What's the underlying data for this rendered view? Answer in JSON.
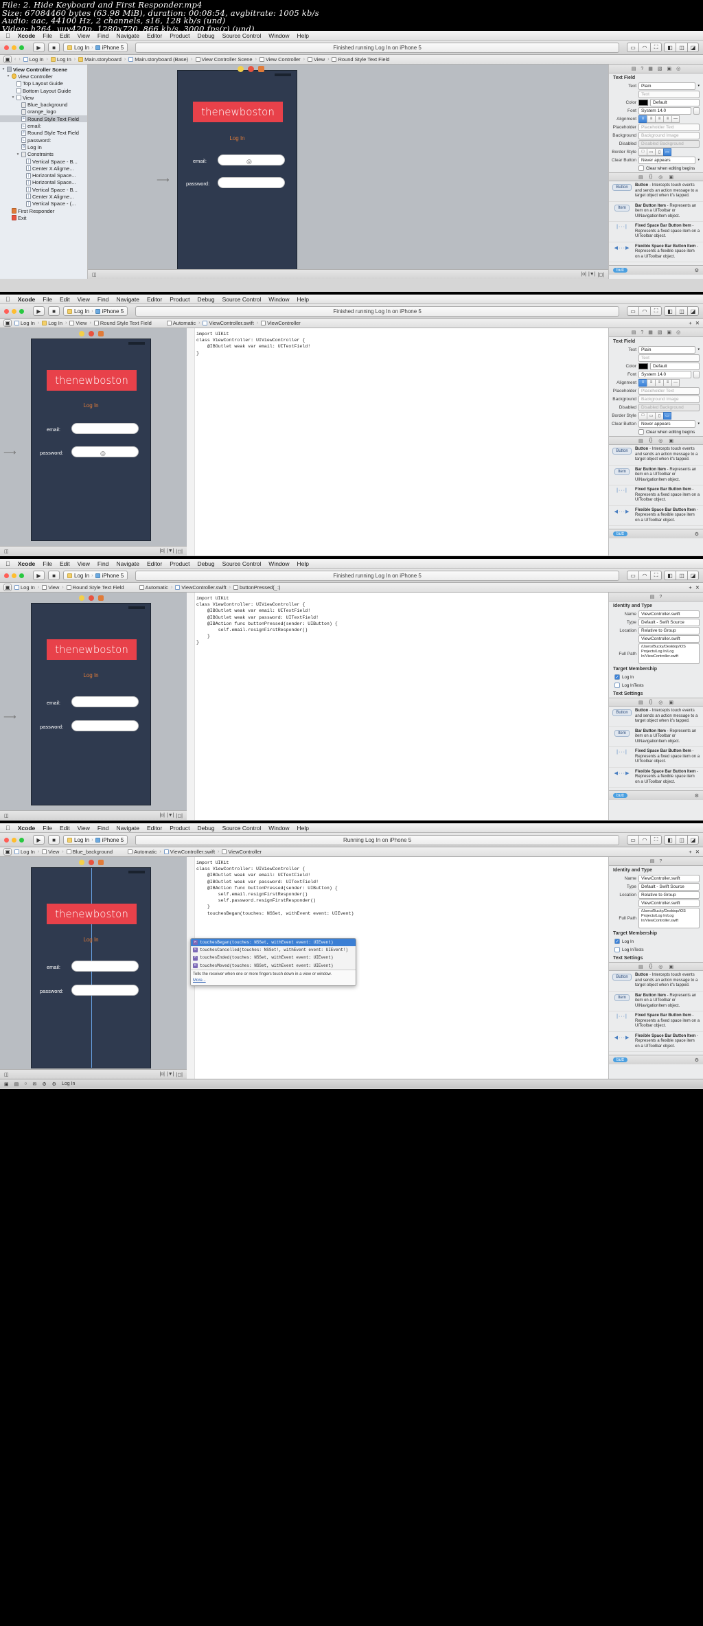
{
  "video_info": {
    "file": "File: 2. Hide Keyboard and First Responder.mp4",
    "size": "Size: 67084460 bytes (63.98 MiB), duration: 00:08:54, avgbitrate: 1005 kb/s",
    "audio": "Audio: aac, 44100 Hz, 2 channels, s16, 128 kb/s (und)",
    "video": "Video: h264, yuv420p, 1280x720, 866 kb/s, 3000 fps(r) (und)"
  },
  "menu": {
    "apple": "",
    "items": [
      "Xcode",
      "File",
      "Edit",
      "View",
      "Find",
      "Navigate",
      "Editor",
      "Product",
      "Debug",
      "Source Control",
      "Window",
      "Help"
    ]
  },
  "panels": [
    {
      "scheme": "Log In",
      "device": "iPhone 5",
      "status": "Finished running Log In on iPhone 5",
      "jumpbar": [
        "Log In",
        "Log In",
        "Main.storyboard",
        "Main.storyboard (Base)",
        "View Controller Scene",
        "View Controller",
        "View",
        "Round Style Text Field"
      ],
      "navigator": [
        {
          "label": "View Controller Scene",
          "depth": 0,
          "arrow": "▾",
          "icon": "scene-icon",
          "bold": true
        },
        {
          "label": "View Controller",
          "depth": 1,
          "arrow": "▾",
          "icon": "view-controller-icon"
        },
        {
          "label": "Top Layout Guide",
          "depth": 2,
          "arrow": "",
          "icon": "layout-guide-icon"
        },
        {
          "label": "Bottom Layout Guide",
          "depth": 2,
          "arrow": "",
          "icon": "layout-guide-icon"
        },
        {
          "label": "View",
          "depth": 2,
          "arrow": "▾",
          "icon": "view-icon"
        },
        {
          "label": "Blue_background",
          "depth": 3,
          "arrow": "",
          "icon": "image-icon"
        },
        {
          "label": "orange_logo",
          "depth": 3,
          "arrow": "",
          "icon": "image-icon"
        },
        {
          "label": "Round Style Text Field",
          "depth": 3,
          "arrow": "",
          "icon": "textfield-icon",
          "selected": true
        },
        {
          "label": "email:",
          "depth": 3,
          "arrow": "",
          "icon": "label-icon"
        },
        {
          "label": "Round Style Text Field",
          "depth": 3,
          "arrow": "",
          "icon": "textfield-icon"
        },
        {
          "label": "password:",
          "depth": 3,
          "arrow": "",
          "icon": "label-icon"
        },
        {
          "label": "Log In",
          "depth": 3,
          "arrow": "",
          "icon": "button-icon"
        },
        {
          "label": "Constraints",
          "depth": 3,
          "arrow": "▾",
          "icon": "constraints-icon"
        },
        {
          "label": "Vertical Space - B...",
          "depth": 4,
          "arrow": "",
          "icon": "constraint-icon"
        },
        {
          "label": "Center X Aligme...",
          "depth": 4,
          "arrow": "",
          "icon": "constraint-icon"
        },
        {
          "label": "Horizontal Space...",
          "depth": 4,
          "arrow": "",
          "icon": "constraint-icon"
        },
        {
          "label": "Horizontal Space...",
          "depth": 4,
          "arrow": "",
          "icon": "constraint-icon"
        },
        {
          "label": "Vertical Space - B...",
          "depth": 4,
          "arrow": "",
          "icon": "constraint-icon"
        },
        {
          "label": "Center X Aligme...",
          "depth": 4,
          "arrow": "",
          "icon": "constraint-icon"
        },
        {
          "label": "Vertical Space - (...",
          "depth": 4,
          "arrow": "",
          "icon": "constraint-icon"
        },
        {
          "label": "First Responder",
          "depth": 1,
          "arrow": "",
          "icon": "first-responder-icon"
        },
        {
          "label": "Exit",
          "depth": 1,
          "arrow": "",
          "icon": "exit-icon"
        }
      ],
      "phone": {
        "logo": "thenewboston",
        "login_label": "Log In",
        "email_label": "email:",
        "password_label": "password:"
      },
      "inspector": {
        "title": "Text Field",
        "rows": [
          {
            "label": "Text",
            "type": "select",
            "value": "Plain"
          },
          {
            "label": "",
            "type": "text",
            "value": "",
            "placeholder": "Text"
          },
          {
            "label": "Color",
            "type": "color",
            "value": "Default"
          },
          {
            "label": "Font",
            "type": "font",
            "value": "System 14.0"
          },
          {
            "label": "Alignment",
            "type": "segments"
          },
          {
            "label": "Placeholder",
            "type": "text",
            "value": "",
            "placeholder": "Placeholder Text"
          },
          {
            "label": "Background",
            "type": "text",
            "value": "",
            "placeholder": "Background Image"
          },
          {
            "label": "Disabled",
            "type": "text",
            "value": "",
            "placeholder": "Disabled Background"
          },
          {
            "label": "Border Style",
            "type": "border"
          },
          {
            "label": "Clear Button",
            "type": "select",
            "value": "Never appears"
          },
          {
            "label": "",
            "type": "check",
            "value": "Clear when editing begins"
          }
        ]
      }
    },
    {
      "scheme": "Log In",
      "device": "iPhone 5",
      "status": "Finished running Log In on iPhone 5",
      "jumpbar": [
        "Log In",
        "Log In",
        "View",
        "Round Style Text Field"
      ],
      "jumpbar2": [
        "Automatic",
        "ViewController.swift",
        "ViewController"
      ],
      "code": [
        "import UIKit",
        "",
        "class ViewController: UIViewController {",
        "",
        "    @IBOutlet weak var email: UITextField!",
        "",
        "}"
      ],
      "inspector": {
        "title": "Text Field",
        "rows": [
          {
            "label": "Text",
            "type": "select",
            "value": "Plain"
          },
          {
            "label": "",
            "type": "text",
            "value": "",
            "placeholder": "Text"
          },
          {
            "label": "Color",
            "type": "color",
            "value": "Default"
          },
          {
            "label": "Font",
            "type": "font",
            "value": "System 14.0"
          },
          {
            "label": "Alignment",
            "type": "segments"
          },
          {
            "label": "Placeholder",
            "type": "text",
            "value": "",
            "placeholder": "Placeholder Text"
          },
          {
            "label": "Background",
            "type": "text",
            "value": "",
            "placeholder": "Background Image"
          },
          {
            "label": "Disabled",
            "type": "text",
            "value": "",
            "placeholder": "Disabled Background"
          },
          {
            "label": "Border Style",
            "type": "border"
          },
          {
            "label": "Clear Button",
            "type": "select",
            "value": "Never appears"
          },
          {
            "label": "",
            "type": "check",
            "value": "Clear when editing begins"
          }
        ]
      }
    },
    {
      "scheme": "Log In",
      "device": "iPhone 5",
      "status": "Finished running Log In on iPhone 5",
      "jumpbar": [
        "Log In",
        "View",
        "Round Style Text Field"
      ],
      "jumpbar2": [
        "Automatic",
        "ViewController.swift",
        "buttonPressed(_:)"
      ],
      "code": [
        "import UIKit",
        "",
        "class ViewController: UIViewController {",
        "",
        "    @IBOutlet weak var email: UITextField!",
        "    @IBOutlet weak var password: UITextField!",
        "",
        "    @IBAction func buttonPressed(sender: UIButton) {",
        "        self.email.resignFirstResponder()",
        "    }",
        "",
        "}"
      ],
      "inspector": {
        "title": "Identity and Type",
        "identity": [
          {
            "label": "Name",
            "value": "ViewController.swift"
          },
          {
            "label": "Type",
            "value": "Default - Swift Source"
          },
          {
            "label": "Location",
            "value": "Relative to Group"
          },
          {
            "label": "",
            "value": "ViewController.swift"
          },
          {
            "label": "Full Path",
            "value": "/Users/Bucky/Desktop/iOS Projects/Log In/Log In/ViewController.swift"
          }
        ],
        "target_membership_title": "Target Membership",
        "targets": [
          {
            "label": "Log In",
            "checked": true
          },
          {
            "label": "Log InTests",
            "checked": false
          }
        ],
        "text_settings_title": "Text Settings"
      }
    },
    {
      "scheme": "Log In",
      "device": "iPhone 5",
      "status": "Running Log In on iPhone 5",
      "jumpbar": [
        "Log In",
        "View",
        "Blue_background"
      ],
      "jumpbar2": [
        "Automatic",
        "ViewController.swift",
        "ViewController"
      ],
      "code": [
        "import UIKit",
        "",
        "class ViewController: UIViewController {",
        "",
        "    @IBOutlet weak var email: UITextField!",
        "    @IBOutlet weak var password: UITextField!",
        "",
        "    @IBAction func buttonPressed(sender: UIButton) {",
        "        self.email.resignFirstResponder()",
        "        self.password.resignFirstResponder()",
        "    }",
        "",
        "",
        "    touchesBegan(touches: NSSet, withEvent event: UIEvent)"
      ],
      "autocomplete": {
        "items": [
          {
            "badge": "M",
            "text": "touchesBegan(touches: NSSet, withEvent event: UIEvent)",
            "selected": true
          },
          {
            "badge": "M",
            "text": "touchesCancelled(touches: NSSet!, withEvent event: UIEvent!)",
            "selected": false
          },
          {
            "badge": "M",
            "text": "touchesEnded(touches: NSSet, withEvent event: UIEvent)",
            "selected": false
          },
          {
            "badge": "M",
            "text": "touchesMoved(touches: NSSet, withEvent event: UIEvent)",
            "selected": false
          }
        ],
        "description": "Tells the receiver when one or more fingers touch down in a view or window.",
        "more": "More..."
      },
      "inspector": {
        "title": "Identity and Type",
        "identity": [
          {
            "label": "Name",
            "value": "ViewController.swift"
          },
          {
            "label": "Type",
            "value": "Default - Swift Source"
          },
          {
            "label": "Location",
            "value": "Relative to Group"
          },
          {
            "label": "",
            "value": "ViewController.swift"
          },
          {
            "label": "Full Path",
            "value": "/Users/Bucky/Desktop/iOS Projects/Log In/Log In/ViewController.swift"
          }
        ],
        "target_membership_title": "Target Membership",
        "targets": [
          {
            "label": "Log In",
            "checked": true
          },
          {
            "label": "Log InTests",
            "checked": false
          }
        ],
        "text_settings_title": "Text Settings"
      },
      "dock_label": "Log In"
    }
  ],
  "library": [
    {
      "icon": "Button",
      "title": "Button",
      "desc": " - Intercepts touch events and sends an action message to a target object when it's tapped."
    },
    {
      "icon": "Item",
      "title": "Bar Button Item",
      "desc": " - Represents an item on a UIToolbar or UINavigationItem object."
    },
    {
      "icon": "dots-fixed",
      "title": "Fixed Space Bar Button Item",
      "desc": " - Represents a fixed space item on a UIToolbar object."
    },
    {
      "icon": "dots-flex",
      "title": "Flexible Space Bar Button Item",
      "desc": " - Represents a flexible space item on a UIToolbar object."
    }
  ],
  "bottom": {
    "filter_placeholder": "butt",
    "label": "butt"
  },
  "colors": {
    "phone_bg": "#2f3a4f",
    "logo_red": "#e8414a",
    "accent_orange": "#e07b39",
    "selection_blue": "#3b7fd4"
  }
}
